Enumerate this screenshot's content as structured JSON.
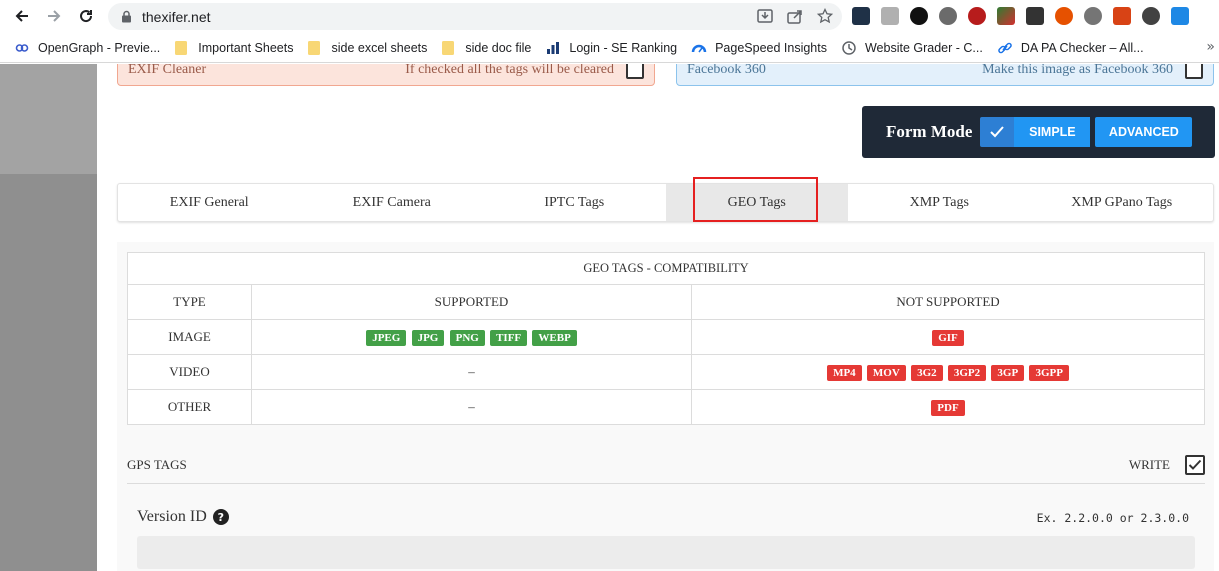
{
  "browser": {
    "url": "thexifer.net",
    "bookmarks": [
      {
        "label": "OpenGraph - Previe...",
        "icon": "opengraph-icon"
      },
      {
        "label": "Important Sheets",
        "icon": "folder-icon"
      },
      {
        "label": "side excel sheets",
        "icon": "folder-icon"
      },
      {
        "label": "side doc file",
        "icon": "folder-icon"
      },
      {
        "label": "Login - SE Ranking",
        "icon": "bar-chart-icon"
      },
      {
        "label": "PageSpeed Insights",
        "icon": "pagespeed-icon"
      },
      {
        "label": "Website Grader - C...",
        "icon": "clock-icon"
      },
      {
        "label": "DA PA Checker – All...",
        "icon": "link-icon"
      }
    ],
    "more_label": "»"
  },
  "top_cards": {
    "left_title": "EXIF Cleaner",
    "left_hint": "If checked all the tags will be cleared",
    "right_title": "Facebook 360",
    "right_hint": "Make this image as Facebook 360"
  },
  "form_mode": {
    "label": "Form Mode",
    "simple": "SIMPLE",
    "advanced": "ADVANCED"
  },
  "tabs": [
    "EXIF General",
    "EXIF Camera",
    "IPTC Tags",
    "GEO Tags",
    "XMP Tags",
    "XMP GPano Tags"
  ],
  "active_tab": "GEO Tags",
  "compat": {
    "caption": "GEO TAGS - COMPATIBILITY",
    "headers": [
      "TYPE",
      "SUPPORTED",
      "NOT SUPPORTED"
    ],
    "rows": [
      {
        "type": "IMAGE",
        "supported": [
          "JPEG",
          "JPG",
          "PNG",
          "TIFF",
          "WEBP"
        ],
        "not_supported": [
          "GIF"
        ]
      },
      {
        "type": "VIDEO",
        "supported_text": "–",
        "not_supported": [
          "MP4",
          "MOV",
          "3G2",
          "3GP2",
          "3GP",
          "3GPP"
        ]
      },
      {
        "type": "OTHER",
        "supported_text": "–",
        "not_supported": [
          "PDF"
        ]
      }
    ]
  },
  "gps": {
    "label": "GPS TAGS",
    "write_label": "WRITE"
  },
  "version": {
    "label": "Version ID",
    "help": "?",
    "example": "Ex. 2.2.0.0 or 2.3.0.0"
  }
}
